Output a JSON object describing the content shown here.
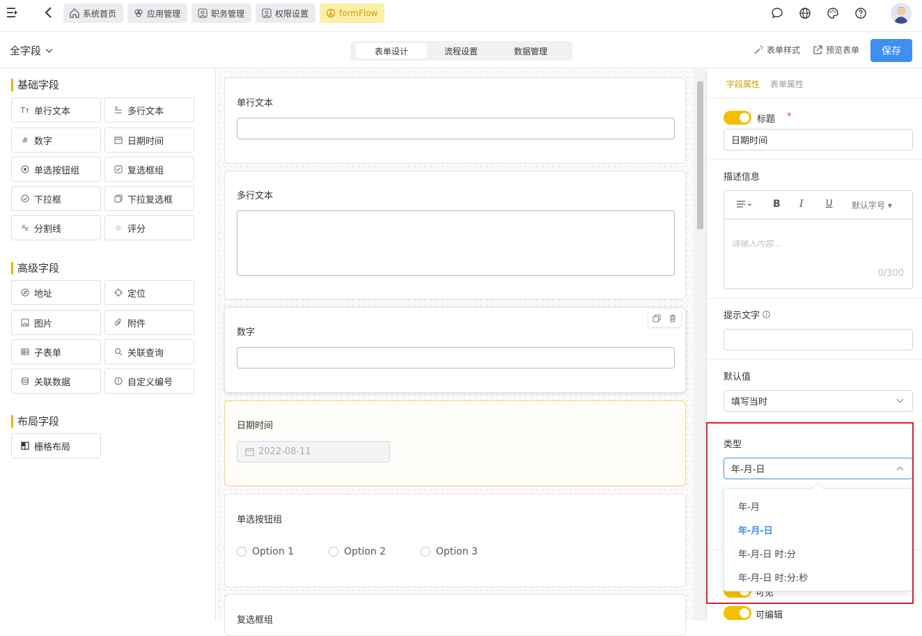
{
  "topbar": {
    "tabs": [
      {
        "label": "系统首页",
        "icon": "home-icon"
      },
      {
        "label": "应用管理",
        "icon": "apps-icon"
      },
      {
        "label": "职务管理",
        "icon": "user-card-icon"
      },
      {
        "label": "权限设置",
        "icon": "user-card-icon"
      },
      {
        "label": "formFlow",
        "icon": "peace-icon"
      }
    ]
  },
  "subbar": {
    "scope": "全字段",
    "segments": [
      "表单设计",
      "流程设置",
      "数据管理"
    ],
    "form_style": "表单样式",
    "preview": "预览表单",
    "save": "保存"
  },
  "left": {
    "basic_title": "基础字段",
    "basic": [
      "单行文本",
      "多行文本",
      "数字",
      "日期时间",
      "单选按钮组",
      "复选框组",
      "下拉框",
      "下拉复选框",
      "分割线",
      "评分"
    ],
    "advanced_title": "高级字段",
    "advanced": [
      "地址",
      "定位",
      "图片",
      "附件",
      "子表单",
      "关联查询",
      "关联数据",
      "自定义编号"
    ],
    "layout_title": "布局字段",
    "layout": [
      "栅格布局"
    ]
  },
  "canvas": {
    "card1": "单行文本",
    "card2": "多行文本",
    "card3": "数字",
    "card4": "日期时间",
    "date_value": "2022-08-11",
    "card5": "单选按钮组",
    "options": [
      "Option 1",
      "Option 2",
      "Option 3"
    ],
    "card6": "复选框组"
  },
  "right": {
    "tab_field": "字段属性",
    "tab_form": "表单属性",
    "title_label": "标题",
    "required_mark": "*",
    "title_value": "日期时间",
    "desc_label": "描述信息",
    "font_size": "默认字号",
    "editor_placeholder": "请输入内容...",
    "counter": "0/300",
    "hint_label": "提示文字",
    "default_label": "默认值",
    "default_value": "填写当时",
    "type_label": "类型",
    "type_value": "年-月-日",
    "type_options": [
      "年-月",
      "年-月-日",
      "年-月-日 时:分",
      "年-月-日 时:分:秒"
    ],
    "visible_partial": "可见",
    "editable": "可编辑"
  },
  "colors": {
    "accent": "#f2c000",
    "primary": "#3d8ff0",
    "highlight_border": "#d9232a"
  }
}
